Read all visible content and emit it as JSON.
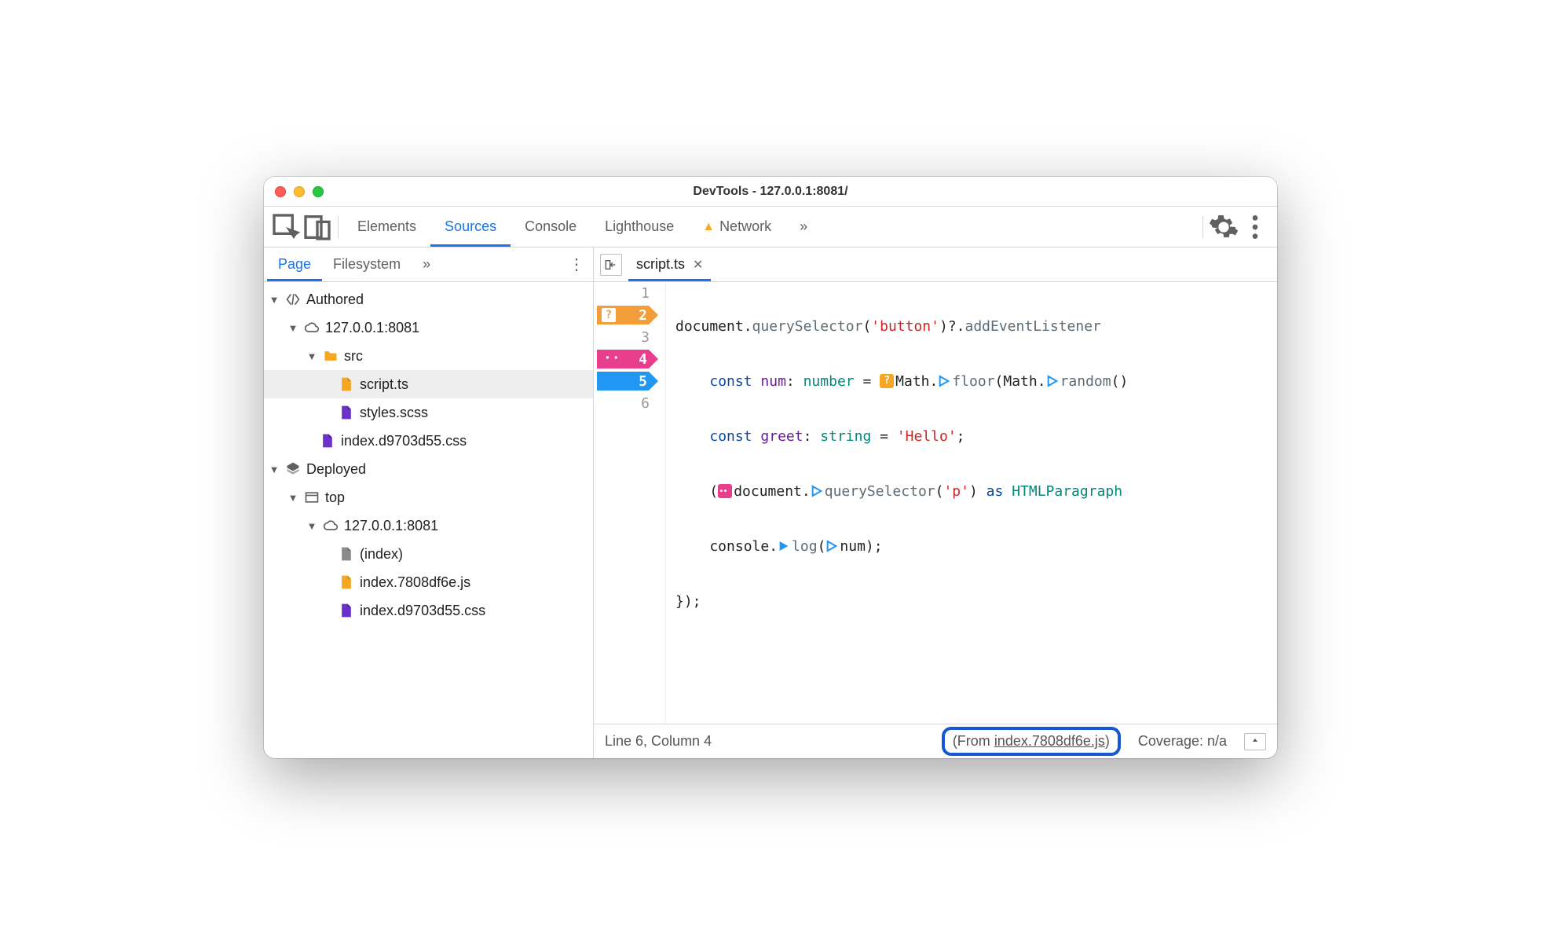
{
  "window": {
    "title": "DevTools - 127.0.0.1:8081/"
  },
  "toolbar": {
    "tabs": {
      "elements": "Elements",
      "sources": "Sources",
      "console": "Console",
      "lighthouse": "Lighthouse",
      "network": "Network"
    },
    "more_glyph": "»"
  },
  "sidebar": {
    "tabs": {
      "page": "Page",
      "filesystem": "Filesystem",
      "more": "»"
    },
    "tree": {
      "authored": "Authored",
      "host1": "127.0.0.1:8081",
      "src": "src",
      "script": "script.ts",
      "styles": "styles.scss",
      "css1": "index.d9703d55.css",
      "deployed": "Deployed",
      "top": "top",
      "host2": "127.0.0.1:8081",
      "index": "(index)",
      "js": "index.7808df6e.js",
      "css2": "index.d9703d55.css"
    }
  },
  "editor": {
    "tab": "script.ts",
    "gutter": {
      "l1": "1",
      "l2": "2",
      "l3": "3",
      "l4": "4",
      "l5": "5",
      "l6": "6",
      "bp2_badge": "?",
      "bp4_badge": "··"
    },
    "code": {
      "l1": {
        "a": "document.",
        "b": "querySelector",
        "c": "(",
        "d": "'button'",
        "e": ")?.",
        "f": "addEventListener"
      },
      "l2": {
        "a": "    ",
        "b": "const",
        "c": " ",
        "d": "num",
        "e": ": ",
        "f": "number",
        "g": " = ",
        "h": "Math",
        "i": ".",
        "j": "floor",
        "k": "(",
        "l": "Math",
        "m": ".",
        "n": "random",
        "o": "()"
      },
      "l3": {
        "a": "    ",
        "b": "const",
        "c": " ",
        "d": "greet",
        "e": ": ",
        "f": "string",
        "g": " = ",
        "h": "'Hello'",
        "i": ";"
      },
      "l4": {
        "a": "    (",
        "b": "document",
        "c": ".",
        "d": "querySelector",
        "e": "(",
        "f": "'p'",
        "g": ") ",
        "h": "as",
        "i": " ",
        "j": "HTMLParagraph"
      },
      "l5": {
        "a": "    console.",
        "b": "log",
        "c": "(",
        "d": "num",
        "e": ");"
      },
      "l6": {
        "a": "});"
      }
    }
  },
  "statusbar": {
    "cursor": "Line 6, Column 4",
    "from_prefix": "(From ",
    "from_link": "index.7808df6e.js",
    "from_suffix": ")",
    "coverage": "Coverage: n/a"
  }
}
